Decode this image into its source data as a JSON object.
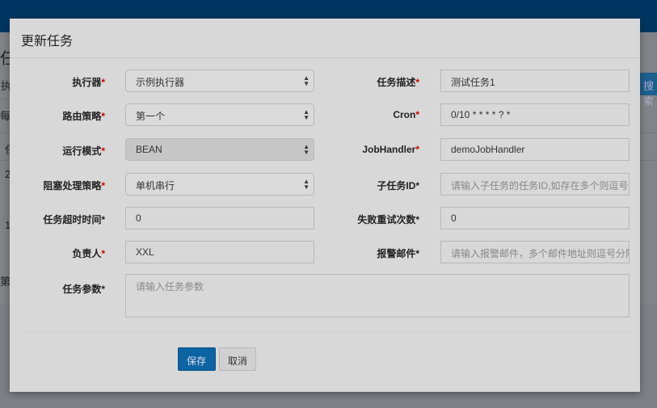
{
  "background": {
    "left_fragments": [
      "任",
      "执",
      "每",
      "任",
      "2",
      "1",
      "第"
    ],
    "search_button": "搜索"
  },
  "modal": {
    "title": "更新任务",
    "left": [
      {
        "label": "执行器",
        "required_mark": "*",
        "red": true,
        "type": "select",
        "value": "示例执行器"
      },
      {
        "label": "路由策略",
        "required_mark": "*",
        "red": true,
        "type": "select",
        "value": "第一个"
      },
      {
        "label": "运行模式",
        "required_mark": "*",
        "red": true,
        "type": "select",
        "value": "BEAN",
        "disabled": true
      },
      {
        "label": "阻塞处理策略",
        "required_mark": "*",
        "red": true,
        "type": "select",
        "value": "单机串行"
      },
      {
        "label": "任务超时时间",
        "required_mark": "*",
        "red": false,
        "type": "input",
        "value": "0"
      },
      {
        "label": "负责人",
        "required_mark": "*",
        "red": true,
        "type": "input",
        "value": "XXL"
      }
    ],
    "right": [
      {
        "label": "任务描述",
        "required_mark": "*",
        "red": true,
        "value": "测试任务1"
      },
      {
        "label": "Cron",
        "required_mark": "*",
        "red": true,
        "value": "0/10 * * * * ? *"
      },
      {
        "label": "JobHandler",
        "required_mark": "*",
        "red": true,
        "value": "demoJobHandler"
      },
      {
        "label": "子任务ID",
        "required_mark": "*",
        "red": false,
        "placeholder": "请输入子任务的任务ID,如存在多个则逗号分隔"
      },
      {
        "label": "失败重试次数",
        "required_mark": "*",
        "red": false,
        "value": "0"
      },
      {
        "label": "报警邮件",
        "required_mark": "*",
        "red": false,
        "placeholder": "请输入报警邮件，多个邮件地址则逗号分隔"
      }
    ],
    "params": {
      "label": "任务参数",
      "required_mark": "*",
      "placeholder": "请输入任务参数"
    },
    "buttons": {
      "save": "保存",
      "cancel": "取消"
    },
    "colors": {
      "header": "#003661",
      "primary": "#0d64a3",
      "required": "#cc0000"
    }
  }
}
